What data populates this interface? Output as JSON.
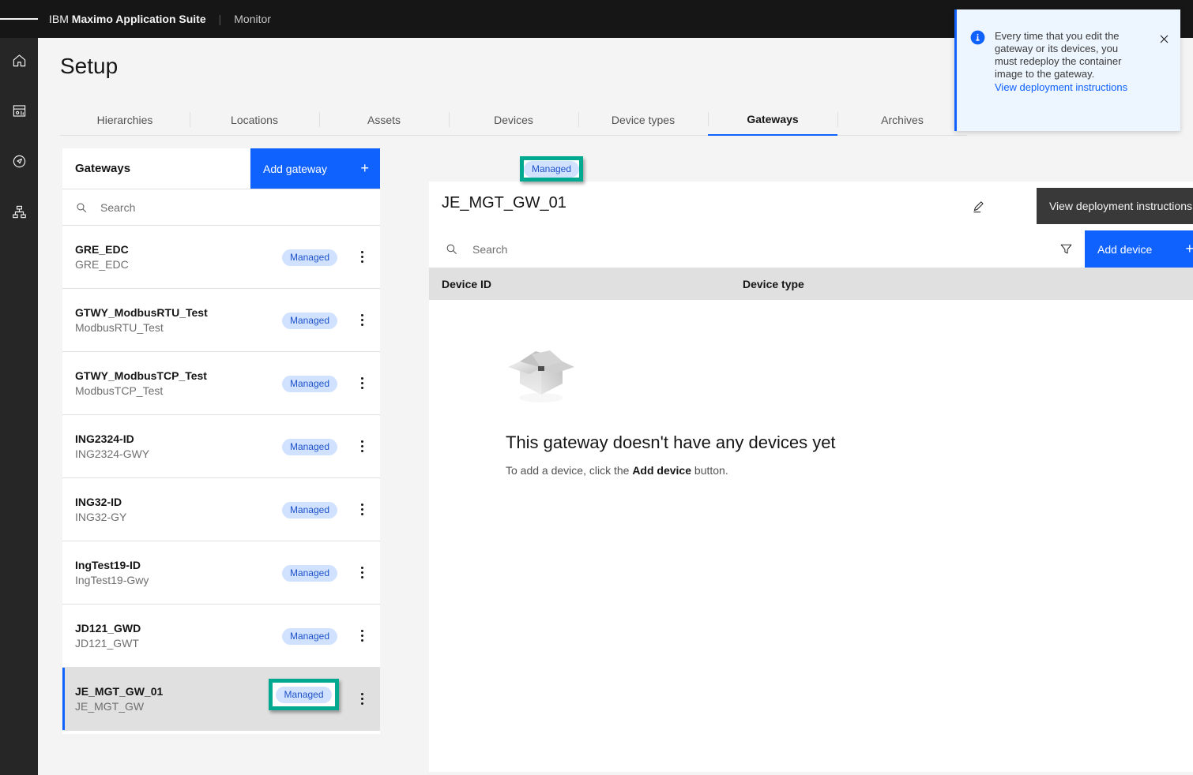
{
  "topbar": {
    "menu_icon": "hamburger-menu-icon",
    "brand_prefix": "IBM",
    "brand_name": "Maximo Application Suite",
    "separator": "|",
    "app_name": "Monitor",
    "icons": [
      "notification-icon",
      "help-icon",
      "user-avatar-icon"
    ],
    "bg": "#161616"
  },
  "rail": {
    "items": [
      {
        "name": "home-icon",
        "label": "Home"
      },
      {
        "name": "dashboard-icon",
        "label": "Dashboard"
      },
      {
        "name": "explore-icon",
        "label": "Explore"
      },
      {
        "name": "hierarchy-icon",
        "label": "Hierarchy"
      }
    ],
    "bg": "#262626"
  },
  "page": {
    "title": "Setup"
  },
  "tabs": {
    "active_index": 6,
    "items": [
      {
        "label": "Hierarchies"
      },
      {
        "label": "Locations"
      },
      {
        "label": "Assets"
      },
      {
        "label": "Devices"
      },
      {
        "label": "Device types"
      },
      {
        "label": "Gateways"
      },
      {
        "label": "Archives"
      }
    ],
    "active_color": "#0f62fe"
  },
  "gateways_panel": {
    "title": "Gateways",
    "add_button": {
      "label": "Add gateway",
      "plus": "+",
      "color": "#0f62fe"
    },
    "search": {
      "placeholder": "Search",
      "value": "",
      "icon": "search-icon"
    },
    "kebab_icon": "overflow-menu-icon",
    "items": [
      {
        "name": "GRE_EDC",
        "sub": "GRE_EDC",
        "badge": "Managed",
        "selected": false
      },
      {
        "name": "GTWY_ModbusRTU_Test",
        "sub": "ModbusRTU_Test",
        "badge": "Managed",
        "selected": false
      },
      {
        "name": "GTWY_ModbusTCP_Test",
        "sub": "ModbusTCP_Test",
        "badge": "Managed",
        "selected": false
      },
      {
        "name": "ING2324-ID",
        "sub": "ING2324-GWY",
        "badge": "Managed",
        "selected": false
      },
      {
        "name": "ING32-ID",
        "sub": "ING32-GY",
        "badge": "Managed",
        "selected": false
      },
      {
        "name": "IngTest19-ID",
        "sub": "IngTest19-Gwy",
        "badge": "Managed",
        "selected": false
      },
      {
        "name": "JD121_GWD",
        "sub": "JD121_GWT",
        "badge": "Managed",
        "selected": false
      },
      {
        "name": "JE_MGT_GW_01",
        "sub": "JE_MGT_GW",
        "badge": "Managed",
        "selected": true
      }
    ],
    "badge_bg": "#d0e2ff",
    "badge_fg": "#1f52c7"
  },
  "detail_panel": {
    "gateway_title": "JE_MGT_GW_01",
    "status_badge": "Managed",
    "edit_icon": "edit-pencil-icon",
    "tooltip": "View deployment instructions",
    "search": {
      "placeholder": "Search",
      "value": "",
      "icon": "search-icon"
    },
    "filter_icon": "filter-icon",
    "add_device_button": {
      "label": "Add device",
      "plus": "+",
      "color": "#0f62fe"
    },
    "columns": [
      "Device ID",
      "Device type"
    ],
    "rows": [],
    "empty_state": {
      "illustration": "empty-open-box-illustration",
      "title": "This gateway doesn't have any devices yet",
      "text_before": "To add a device, click the ",
      "text_bold": "Add device",
      "text_after": " button."
    }
  },
  "toast": {
    "icon": "information-filled-icon",
    "message": "Every time that you edit the gateway or its devices, you must redeploy the container image to the gateway.",
    "link": "View deployment instructions",
    "close_icon": "close-icon",
    "bg": "#edf5ff",
    "accent": "#0f62fe"
  },
  "annotations": {
    "highlight_color": "#00a98f",
    "boxes": [
      {
        "name": "annotation-box-title-badge",
        "target": "Managed"
      },
      {
        "name": "annotation-box-list-badge",
        "target": "Managed"
      }
    ]
  }
}
